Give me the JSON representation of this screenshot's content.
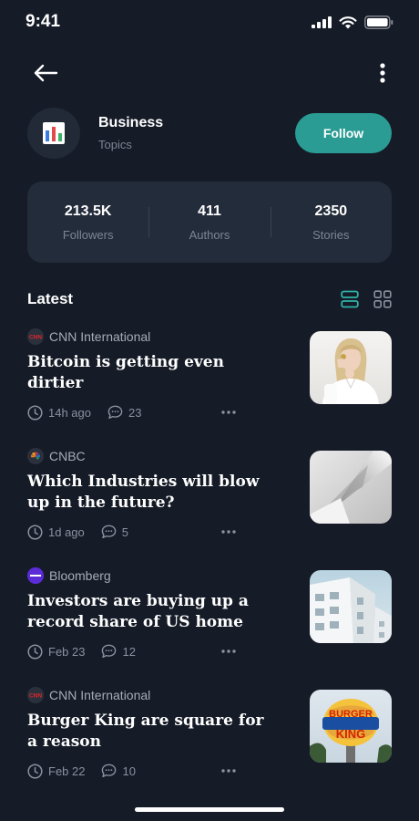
{
  "status": {
    "time": "9:41"
  },
  "topic": {
    "title": "Business",
    "subtitle": "Topics",
    "follow_label": "Follow",
    "icon": "bar-chart-icon"
  },
  "stats": [
    {
      "value": "213.5K",
      "label": "Followers"
    },
    {
      "value": "411",
      "label": "Authors"
    },
    {
      "value": "2350",
      "label": "Stories"
    }
  ],
  "latest": {
    "title": "Latest"
  },
  "articles": [
    {
      "source": "CNN International",
      "headline": "Bitcoin is getting even dirtier",
      "time": "14h ago",
      "comments": "23",
      "thumb": "woman-photo"
    },
    {
      "source": "CNBC",
      "headline": "Which Industries will blow up in the future?",
      "time": "1d ago",
      "comments": "5",
      "thumb": "abstract-gray"
    },
    {
      "source": "Bloomberg",
      "headline": "Investors are buying up a record share of US home",
      "time": "Feb 23",
      "comments": "12",
      "thumb": "white-building"
    },
    {
      "source": "CNN International",
      "headline": "Burger King are square for a reason",
      "time": "Feb 22",
      "comments": "10",
      "thumb": "burger-king-logo"
    }
  ],
  "logos": {
    "cnn": "CNN"
  },
  "thumb_texts": {
    "burger": "BURGER",
    "king": "KING"
  },
  "colors": {
    "background": "#151b27",
    "card": "#232c3a",
    "accent": "#2a9c94"
  }
}
